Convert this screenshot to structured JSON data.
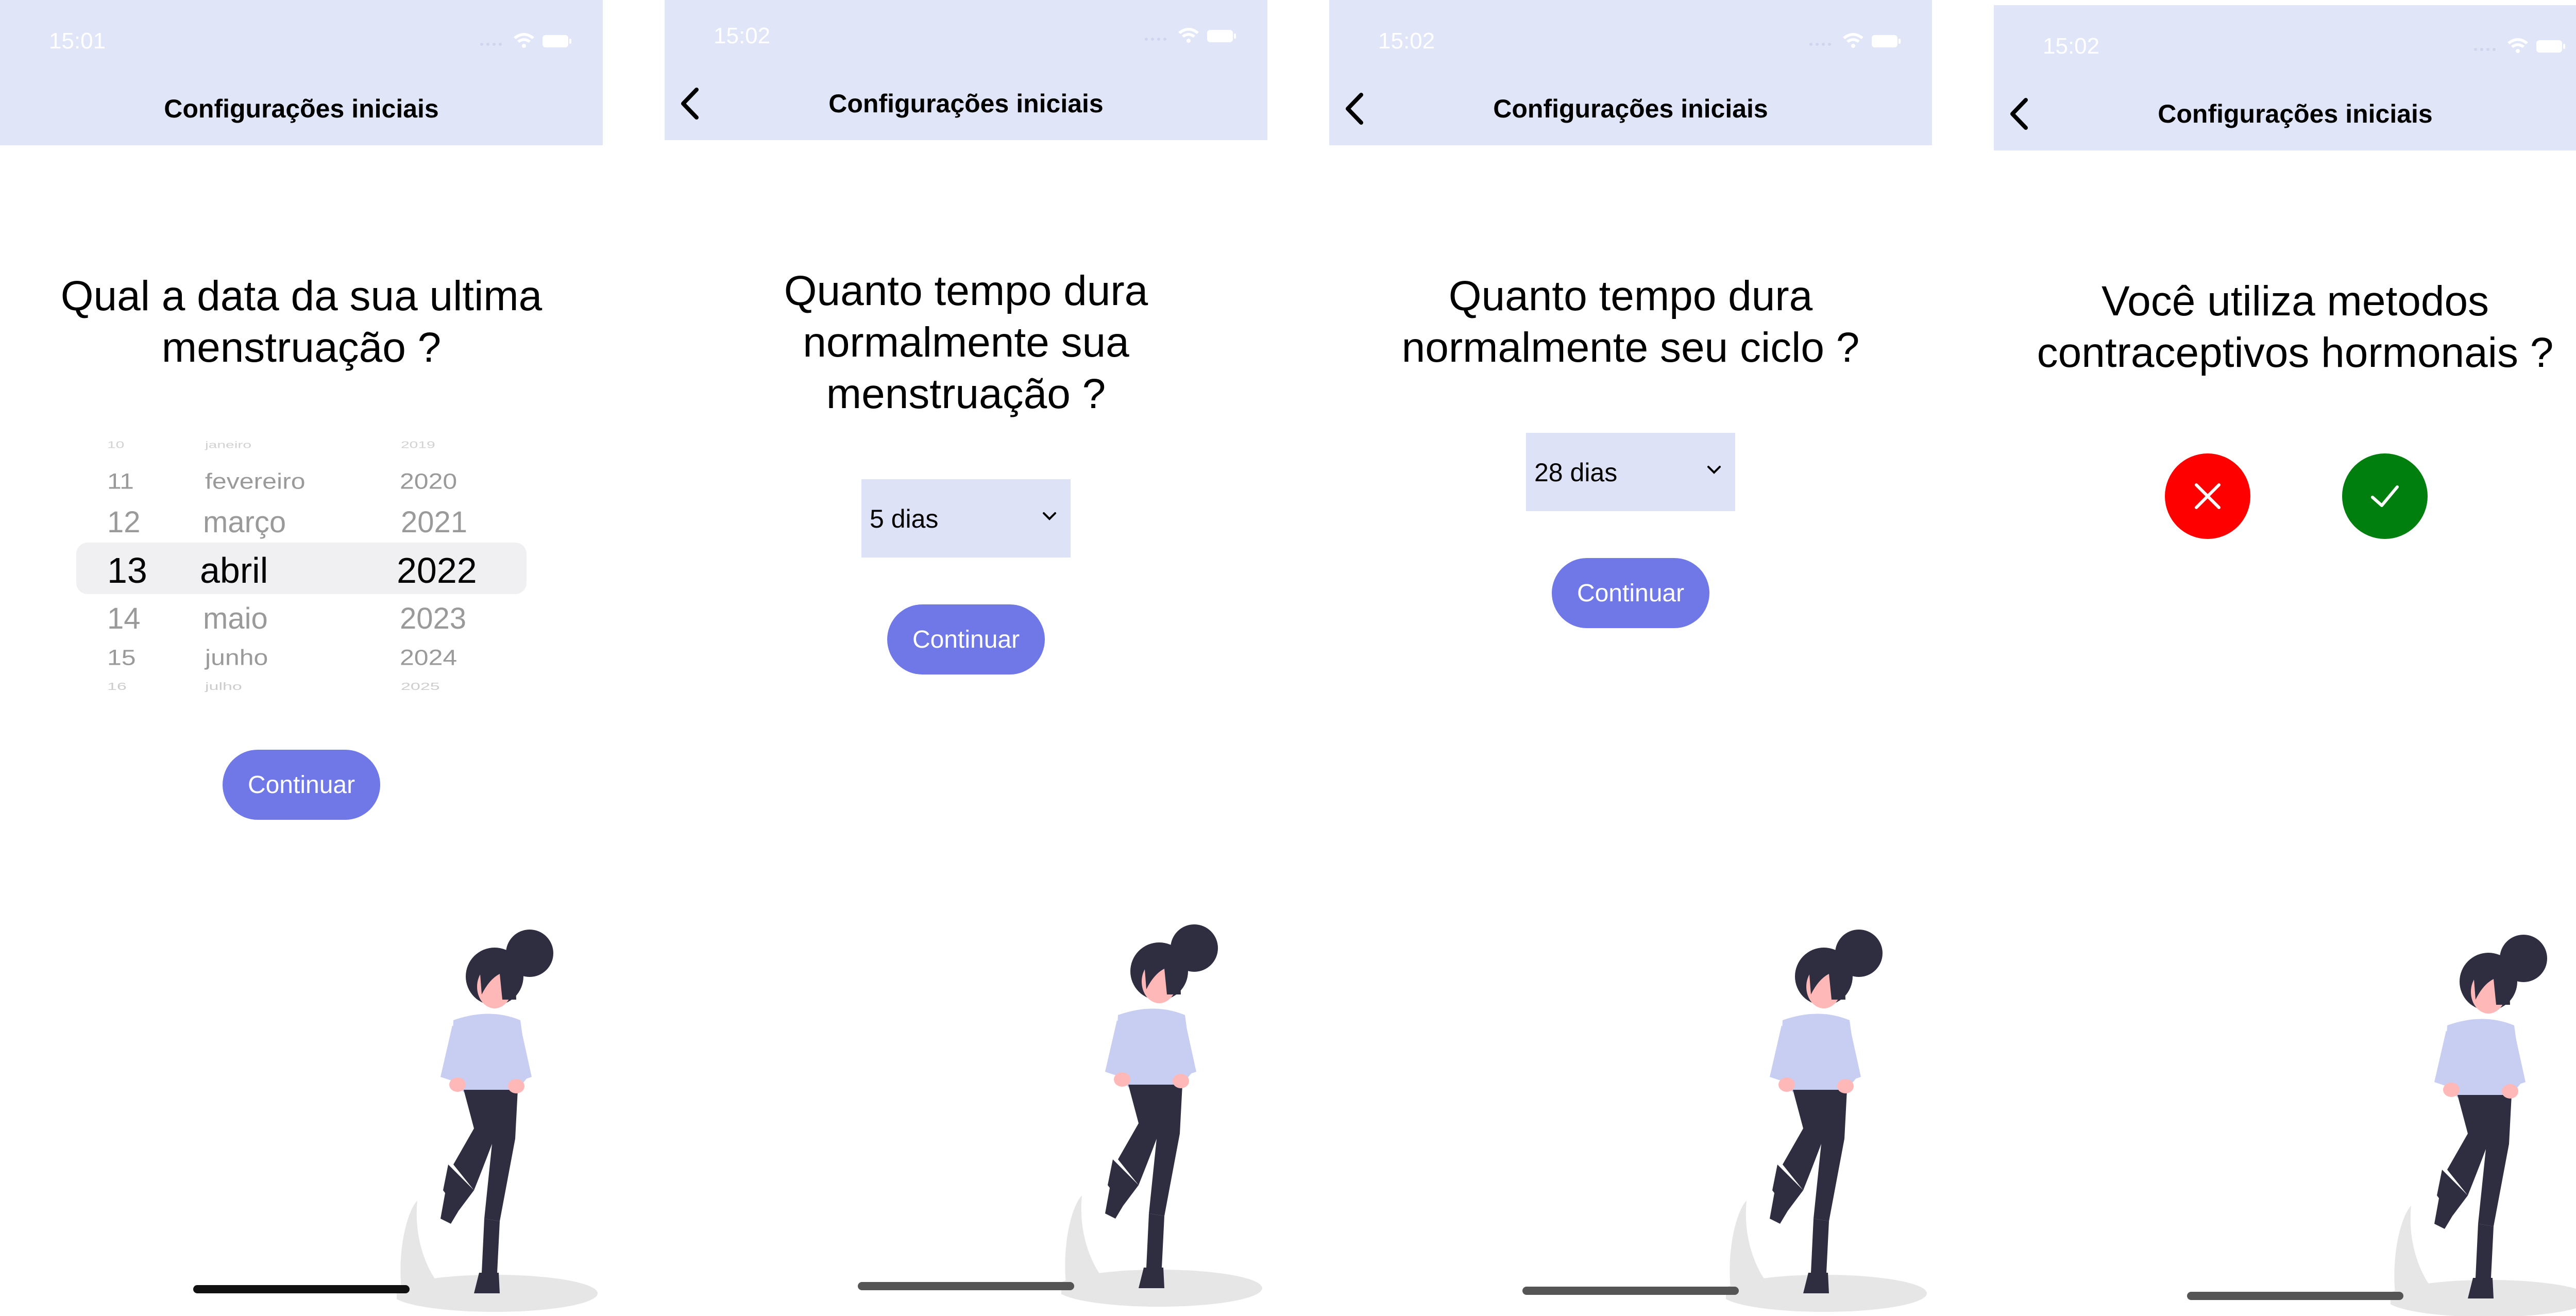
{
  "colors": {
    "header_bg": "#e0e5f7",
    "accent": "#6f78e6",
    "select_bg": "#dde2f6",
    "no": "#ff0000",
    "yes": "#007f0e"
  },
  "screens": [
    {
      "time": "15:01",
      "title": "Configurações iniciais",
      "has_back": false,
      "question": "Qual a data da sua ultima menstruação ?",
      "picker": {
        "days": [
          "10",
          "11",
          "12",
          "13",
          "14",
          "15",
          "16"
        ],
        "months": [
          "janeiro",
          "fevereiro",
          "março",
          "abril",
          "maio",
          "junho",
          "julho"
        ],
        "years": [
          "2019",
          "2020",
          "2021",
          "2022",
          "2023",
          "2024",
          "2025"
        ],
        "selected": {
          "day": "13",
          "month": "abril",
          "year": "2022"
        }
      },
      "continue_label": "Continuar"
    },
    {
      "time": "15:02",
      "title": "Configurações iniciais",
      "has_back": true,
      "question": "Quanto tempo dura normalmente sua menstruação ?",
      "select_value": "5 dias",
      "continue_label": "Continuar"
    },
    {
      "time": "15:02",
      "title": "Configurações iniciais",
      "has_back": true,
      "question": "Quanto tempo dura normalmente seu ciclo ?",
      "select_value": "28 dias",
      "continue_label": "Continuar"
    },
    {
      "time": "15:02",
      "title": "Configurações iniciais",
      "has_back": true,
      "question": "Você utiliza metodos contraceptivos hormonais ?",
      "no_icon": "close-icon",
      "yes_icon": "check-icon"
    }
  ]
}
